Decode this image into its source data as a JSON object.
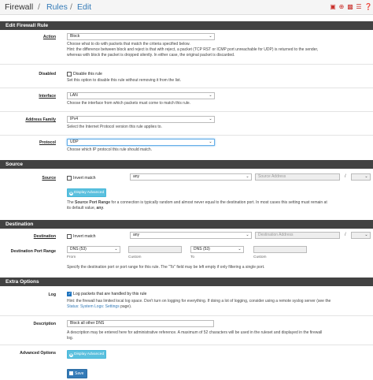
{
  "breadcrumb": {
    "part1": "Firewall",
    "sep1": "/",
    "part2": "Rules",
    "sep2": "/",
    "part3": "Edit"
  },
  "toolbar": {
    "icons": [
      "page-icon",
      "plus-icon",
      "chart-icon",
      "list-icon",
      "help-icon"
    ]
  },
  "edit_panel": {
    "title": "Edit Firewall Rule",
    "action": {
      "label": "Action",
      "value": "Block",
      "help": [
        "Choose what to do with packets that match the criteria specified below.",
        "Hint: the difference between block and reject is that with reject, a packet (TCP RST or ICMP port unreachable for UDP) is returned to the sender,",
        "whereas with block the packet is dropped silently. In either case, the original packet is discarded."
      ]
    },
    "disabled": {
      "label": "Disabled",
      "checkbox_label": "Disable this rule",
      "help": "Set this option to disable this rule without removing it from the list."
    },
    "interface": {
      "label": "Interface",
      "value": "LAN",
      "help": "Choose the interface from which packets must come to match this rule."
    },
    "address_family": {
      "label": "Address Family",
      "value": "IPv4",
      "help": "Select the Internet Protocol version this rule applies to."
    },
    "protocol": {
      "label": "Protocol",
      "value": "UDP",
      "help": "Choose which IP protocol this rule should match."
    }
  },
  "source_panel": {
    "title": "Source",
    "label": "Source",
    "invert_label": "Invert match",
    "type_value": "any",
    "address_placeholder": "Source Address",
    "slash": "/",
    "display_advanced": "Display Advanced",
    "help_prefix": "The ",
    "help_bold": "Source Port Range",
    "help_suffix": " for a connection is typically random and almost never equal to the destination port. In most cases this setting must remain at",
    "help_line2_prefix": "its default value, ",
    "help_line2_bold": "any",
    "help_line2_suffix": "."
  },
  "destination_panel": {
    "title": "Destination",
    "label": "Destination",
    "invert_label": "Invert match",
    "type_value": "any",
    "address_placeholder": "Destination Address",
    "slash": "/",
    "port_label": "Destination Port Range",
    "from_value": "DNS (53)",
    "to_value": "DNS (53)",
    "from_caption": "From",
    "custom_caption1": "Custom",
    "to_caption": "To",
    "custom_caption2": "Custom",
    "help": "Specify the destination port or port range for this rule. The \"To\" field may be left empty if only filtering a single port."
  },
  "extra_panel": {
    "title": "Extra Options",
    "log": {
      "label": "Log",
      "checkbox_label": "Log packets that are handled by this rule",
      "help_line1": "Hint: the firewall has limited local log space. Don't turn on logging for everything. If doing a lot of logging, consider using a remote syslog server (see the",
      "help_link": "Status: System Logs: Settings",
      "help_line2_suffix": " page)."
    },
    "description": {
      "label": "Description",
      "value": "Block all other DNS",
      "help_line1": "A description may be entered here for administrative reference. A maximum of 52 characters will be used in the ruleset and displayed in the firewall",
      "help_line2": "log."
    },
    "advanced": {
      "label": "Advanced Options",
      "button": "Display Advanced"
    }
  },
  "save_button": "Save",
  "chevron": "⌄"
}
